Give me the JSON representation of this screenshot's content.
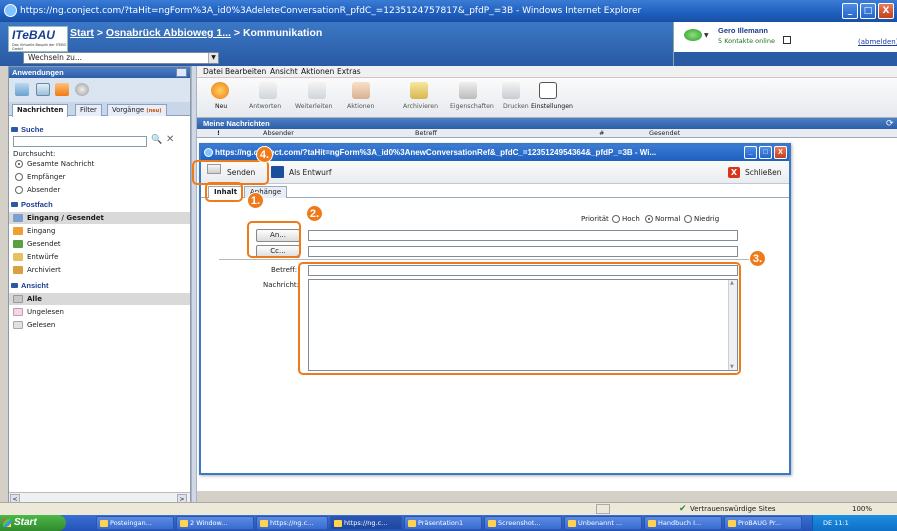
{
  "window": {
    "title": "https://ng.conject.com/?taHit=ngForm%3A_id0%3AdeleteConversationR_pfdC_=1235124757817&_pfdP_=3B - Windows Internet Explorer",
    "btn_min": "_",
    "btn_max": "□",
    "btn_close": "X"
  },
  "header": {
    "logo_main": "ITe",
    "logo_accent": "BAU",
    "logo_sub": "Das Virtuelle Baupkt der ITEBO GmbH",
    "crumb_start": "Start",
    "crumb_sep1": " > ",
    "crumb_project": "Osnabrück Abbioweg 1...",
    "crumb_sep2": " > ",
    "crumb_section": "Kommunikation",
    "switch_label": "Wechseln zu...",
    "switch_arrow": "▼"
  },
  "user": {
    "name": "Gero Illemann",
    "status": "5 Kontakte online",
    "logout": "(abmelden)",
    "bubble_arrow": "▼"
  },
  "sidebar": {
    "title": "Anwendungen",
    "tabs": [
      {
        "label": "Nachrichten"
      },
      {
        "label": "Filter"
      },
      {
        "label": "Vorgänge",
        "badge": "(neu)"
      }
    ],
    "search": {
      "title": "Suche",
      "search_icon": "🔍",
      "clear_icon": "✕",
      "scope_label": "Durchsucht:",
      "options": [
        "Gesamte Nachricht",
        "Empfänger",
        "Absender"
      ]
    },
    "mailbox": {
      "title": "Postfach",
      "items": [
        "Eingang / Gesendet",
        "Eingang",
        "Gesendet",
        "Entwürfe",
        "Archiviert"
      ]
    },
    "view": {
      "title": "Ansicht",
      "items": [
        "Alle",
        "Ungelesen",
        "Gelesen"
      ]
    },
    "scroll_left": "<",
    "scroll_right": ">"
  },
  "menubar": [
    "Datei",
    "Bearbeiten",
    "Ansicht",
    "Aktionen",
    "Extras"
  ],
  "toolbar": [
    "Neu",
    "Antworten",
    "Weiterleiten",
    "Aktionen",
    "Archivieren",
    "Eigenschaften",
    "Drucken",
    "Einstellungen"
  ],
  "messages": {
    "title": "Meine Nachrichten",
    "refresh_icon": "⟳",
    "columns": [
      "!",
      "Absender",
      "Betreff",
      "#",
      "Gesendet"
    ]
  },
  "compose": {
    "title": "https://ng.conject.com/?taHit=ngForm%3A_id0%3AnewConversationRef&_pfdC_=1235124954364&_pfdP_=3B - Wi...",
    "title_prefix": "https://",
    "btn_min": "_",
    "btn_max": "□",
    "btn_close": "X",
    "send": "Senden",
    "draft": "Als Entwurf",
    "close": "Schließen",
    "close_icon": "X",
    "tabs": [
      "Inhalt",
      "Anhänge"
    ],
    "priority_label": "Priorität",
    "priority_options": [
      "Hoch",
      "Normal",
      "Niedrig"
    ],
    "to_button": "An...",
    "cc_button": "Cc...",
    "subject_label": "Betreff:",
    "body_label": "Nachricht:",
    "scroll_up": "▲",
    "scroll_down": "▼"
  },
  "callouts": [
    "1.",
    "2.",
    "3.",
    "4."
  ],
  "statusbar": {
    "secure": "Vertrauenswürdige Sites",
    "check": "✔",
    "zoom": "100%"
  },
  "taskbar": {
    "start": "Start",
    "tasks": [
      "Posteingan...",
      "2 Window...",
      "https://ng.c...",
      "https://ng.c...",
      "Präsentation1",
      "Screenshot...",
      "Unbenannt ...",
      "Handbuch I...",
      "ProBAUG Pr..."
    ],
    "tray": "DE  11:1"
  }
}
